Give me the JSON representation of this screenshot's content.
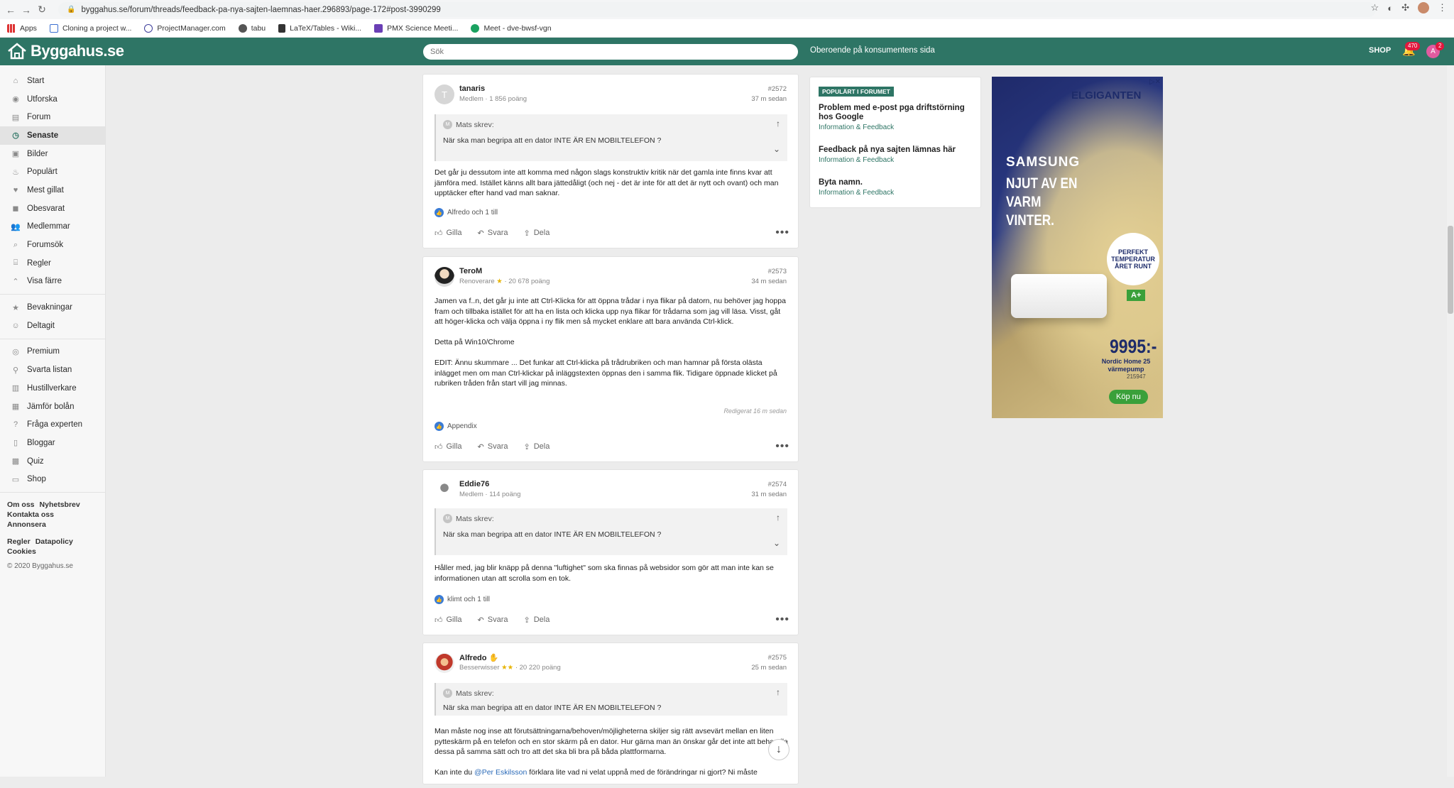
{
  "browser": {
    "url": "byggahus.se/forum/threads/feedback-pa-nya-sajten-laemnas-haer.296893/page-172#post-3990299",
    "bookmarks": [
      "Apps",
      "Cloning a project w...",
      "ProjectManager.com",
      "tabu",
      "LaTeX/Tables - Wiki...",
      "PMX Science Meeti...",
      "Meet - dve-bwsf-vgn"
    ]
  },
  "site": {
    "logo": "Byggahus.se",
    "search_placeholder": "Sök",
    "tagline": "Oberoende på konsumentens sida",
    "shop": "SHOP",
    "notifications": "470",
    "messages": "2",
    "user_initial": "A"
  },
  "sidebar": {
    "items": [
      "Start",
      "Utforska",
      "Forum",
      "Senaste",
      "Bilder",
      "Populärt",
      "Mest gillat",
      "Obesvarat",
      "Medlemmar",
      "Forumsök",
      "Regler",
      "Visa färre"
    ],
    "items2": [
      "Bevakningar",
      "Deltagit"
    ],
    "items3": [
      "Premium",
      "Svarta listan",
      "Hustillverkare",
      "Jämför bolån",
      "Fråga experten",
      "Bloggar",
      "Quiz",
      "Shop"
    ],
    "footer1": [
      "Om oss",
      "Nyhetsbrev",
      "Kontakta oss",
      "Annonsera"
    ],
    "footer2": [
      "Regler",
      "Datapolicy",
      "Cookies"
    ],
    "copyright": "© 2020 Byggahus.se"
  },
  "labels": {
    "like": "Gilla",
    "reply": "Svara",
    "share": "Dela",
    "quote_author": "Mats skrev:"
  },
  "posts": [
    {
      "author": "tanaris",
      "initial": "T",
      "meta": "Medlem · 1 856 poäng",
      "num": "#2572",
      "time": "37 m sedan",
      "quote": "När ska man begripa att en dator INTE ÄR EN MOBILTELEFON ?",
      "body": [
        "Det går ju dessutom inte att komma med någon slags konstruktiv kritik när det gamla inte finns kvar att jämföra med. Istället känns allt bara jättedåligt (och nej - det är inte för att det är nytt och ovant) och man upptäcker efter hand vad man saknar."
      ],
      "reactions": "Alfredo och 1 till"
    },
    {
      "author": "TeroM",
      "meta_role": "Renoverare",
      "meta_points": "· 20 678 poäng",
      "num": "#2573",
      "time": "34 m sedan",
      "body": [
        "Jamen va f..n, det går ju inte att Ctrl-Klicka för att öppna trådar i nya flikar på datorn, nu behöver jag hoppa fram och tillbaka istället för att ha en lista och klicka upp nya flikar för trådarna som jag vill läsa. Visst, gåt att höger-klicka och välja öppna i ny flik men så mycket enklare att bara använda Ctrl-klick.",
        "Detta på Win10/Chrome",
        "EDIT: Ännu skummare ... Det funkar att Ctrl-klicka på trådrubriken och man hamnar på första olästa inlägget men om man Ctrl-klickar på inläggstexten öppnas den i samma flik. Tidigare öppnade klicket på rubriken tråden från start vill jag minnas."
      ],
      "edited": "Redigerat 16 m sedan",
      "reactions": "Appendix"
    },
    {
      "author": "Eddie76",
      "meta": "Medlem · 114 poäng",
      "num": "#2574",
      "time": "31 m sedan",
      "quote": "När ska man begripa att en dator INTE ÄR EN MOBILTELEFON ?",
      "body": [
        "Håller med, jag blir knäpp på denna \"luftighet\" som ska finnas på websidor som gör att man inte kan se informationen utan att scrolla som en tok."
      ],
      "reactions": "klimt och 1 till"
    },
    {
      "author": "Alfredo",
      "meta_role": "Besserwisser",
      "meta_points": "· 20 220 poäng",
      "num": "#2575",
      "time": "25 m sedan",
      "quote": "När ska man begripa att en dator INTE ÄR EN MOBILTELEFON ?",
      "body": [
        "Man måste nog inse att förutsättningarna/behoven/möjligheterna skiljer sig rätt avsevärt mellan en liten pytteskärm på en telefon och en stor skärm på en dator. Hur gärna man än önskar går det inte att behandla dessa på samma sätt och tro att det ska bli bra på båda plattformarna."
      ],
      "body_last_pre": "Kan inte du ",
      "body_last_mention": "@Per Eskilsson",
      "body_last_post": " förklara lite vad ni velat uppnå med de förändringar ni gjort? Ni måste"
    }
  ],
  "popular": {
    "tag": "POPULÄRT I FORUMET",
    "items": [
      {
        "title": "Problem med e-post pga driftstörning hos Google",
        "sub": "Information & Feedback"
      },
      {
        "title": "Feedback på nya sajten lämnas här",
        "sub": "Information & Feedback"
      },
      {
        "title": "Byta namn.",
        "sub": "Information & Feedback"
      }
    ]
  },
  "ad": {
    "store": "ELGIGANTEN",
    "brand": "SAMSUNG",
    "slogan": "NJUT AV EN VARM VINTER.",
    "circle": "PERFEKT TEMPERATUR ÅRET RUNT",
    "energy": "A+",
    "price": "9995:-",
    "desc": "Nordic Home 25 värmepump",
    "sku": "215947",
    "cta": "Köp nu"
  }
}
